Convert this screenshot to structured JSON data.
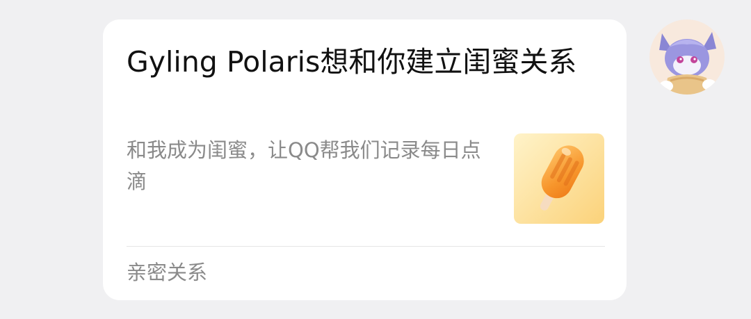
{
  "card": {
    "title": "Gyling Polaris想和你建立闺蜜关系",
    "description": "和我成为闺蜜，让QQ帮我们记录每日点滴",
    "thumbnail_icon": "popsicle-icon",
    "footer": "亲密关系"
  },
  "sender": {
    "avatar_icon": "avatar-icon"
  },
  "colors": {
    "background": "#f0f0f2",
    "card": "#ffffff",
    "title_text": "#111111",
    "secondary_text": "#8a8a8a",
    "thumbnail_bg": "#fde3a0",
    "popsicle": "#f7a23a"
  }
}
